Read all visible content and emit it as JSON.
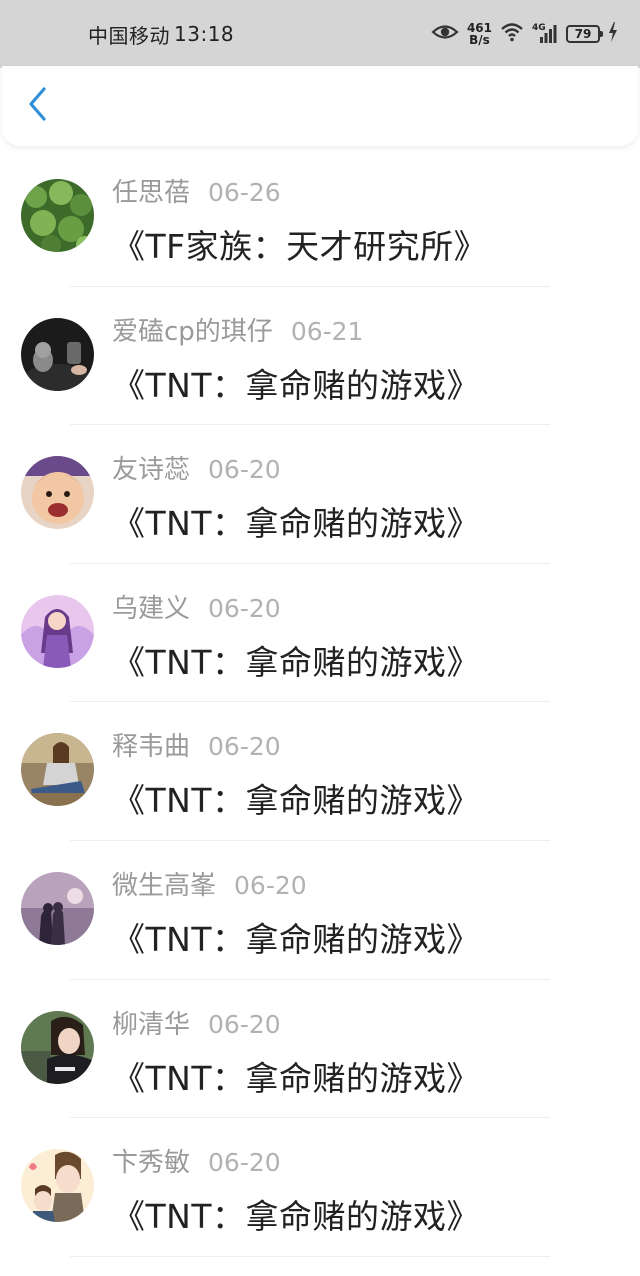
{
  "status_bar": {
    "carrier": "中国移动",
    "time": "13:18",
    "net_speed_value": "461",
    "net_speed_unit": "B/s",
    "network_type": "4G",
    "battery": "79"
  },
  "header": {
    "back_icon": "chevron-left-icon",
    "accent_color": "#2f8fd8"
  },
  "list": {
    "items": [
      {
        "name": "任思蓓",
        "date": "06-26",
        "title": "《TF家族：天才研究所》",
        "avatar": "plant"
      },
      {
        "name": "爱磕cp的琪仔",
        "date": "06-21",
        "title": "《TNT：拿命赌的游戏》",
        "avatar": "cat"
      },
      {
        "name": "友诗蕊",
        "date": "06-20",
        "title": "《TNT：拿命赌的游戏》",
        "avatar": "baby"
      },
      {
        "name": "乌建义",
        "date": "06-20",
        "title": "《TNT：拿命赌的游戏》",
        "avatar": "anime-angel"
      },
      {
        "name": "释韦曲",
        "date": "06-20",
        "title": "《TNT：拿命赌的游戏》",
        "avatar": "woman-sitting"
      },
      {
        "name": "微生高峯",
        "date": "06-20",
        "title": "《TNT：拿命赌的游戏》",
        "avatar": "couple-sunset"
      },
      {
        "name": "柳清华",
        "date": "06-20",
        "title": "《TNT：拿命赌的游戏》",
        "avatar": "woman-portrait"
      },
      {
        "name": "卞秀敏",
        "date": "06-20",
        "title": "《TNT：拿命赌的游戏》",
        "avatar": "cartoon-boys"
      }
    ]
  }
}
